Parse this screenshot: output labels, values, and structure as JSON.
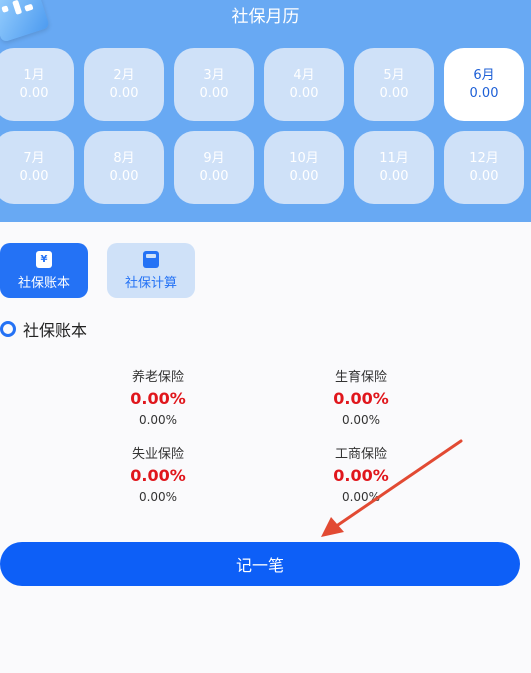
{
  "header": {
    "title": "社保月历"
  },
  "months": [
    {
      "label": "1月",
      "value": "0.00"
    },
    {
      "label": "2月",
      "value": "0.00"
    },
    {
      "label": "3月",
      "value": "0.00"
    },
    {
      "label": "4月",
      "value": "0.00"
    },
    {
      "label": "5月",
      "value": "0.00"
    },
    {
      "label": "6月",
      "value": "0.00",
      "active": true
    },
    {
      "label": "7月",
      "value": "0.00"
    },
    {
      "label": "8月",
      "value": "0.00"
    },
    {
      "label": "9月",
      "value": "0.00"
    },
    {
      "label": "10月",
      "value": "0.00"
    },
    {
      "label": "11月",
      "value": "0.00"
    },
    {
      "label": "12月",
      "value": "0.00"
    }
  ],
  "tabs": {
    "ledger": {
      "label": "社保账本",
      "icon": "yen-icon"
    },
    "calculator": {
      "label": "社保计算",
      "icon": "calculator-icon"
    }
  },
  "section": {
    "title": "社保账本"
  },
  "insurances": {
    "pension": {
      "name": "养老保险",
      "percent": "0.00%",
      "sub": "0.00%"
    },
    "maternity": {
      "name": "生育保险",
      "percent": "0.00%",
      "sub": "0.00%"
    },
    "unemployment": {
      "name": "失业保险",
      "percent": "0.00%",
      "sub": "0.00%"
    },
    "injury": {
      "name": "工商保险",
      "percent": "0.00%",
      "sub": "0.00%"
    }
  },
  "record_button": {
    "label": "记一笔"
  },
  "colors": {
    "header_bg": "#68a9f3",
    "accent": "#0d5ff7",
    "value_red": "#e0161c",
    "annotation_arrow": "#e24a33"
  }
}
